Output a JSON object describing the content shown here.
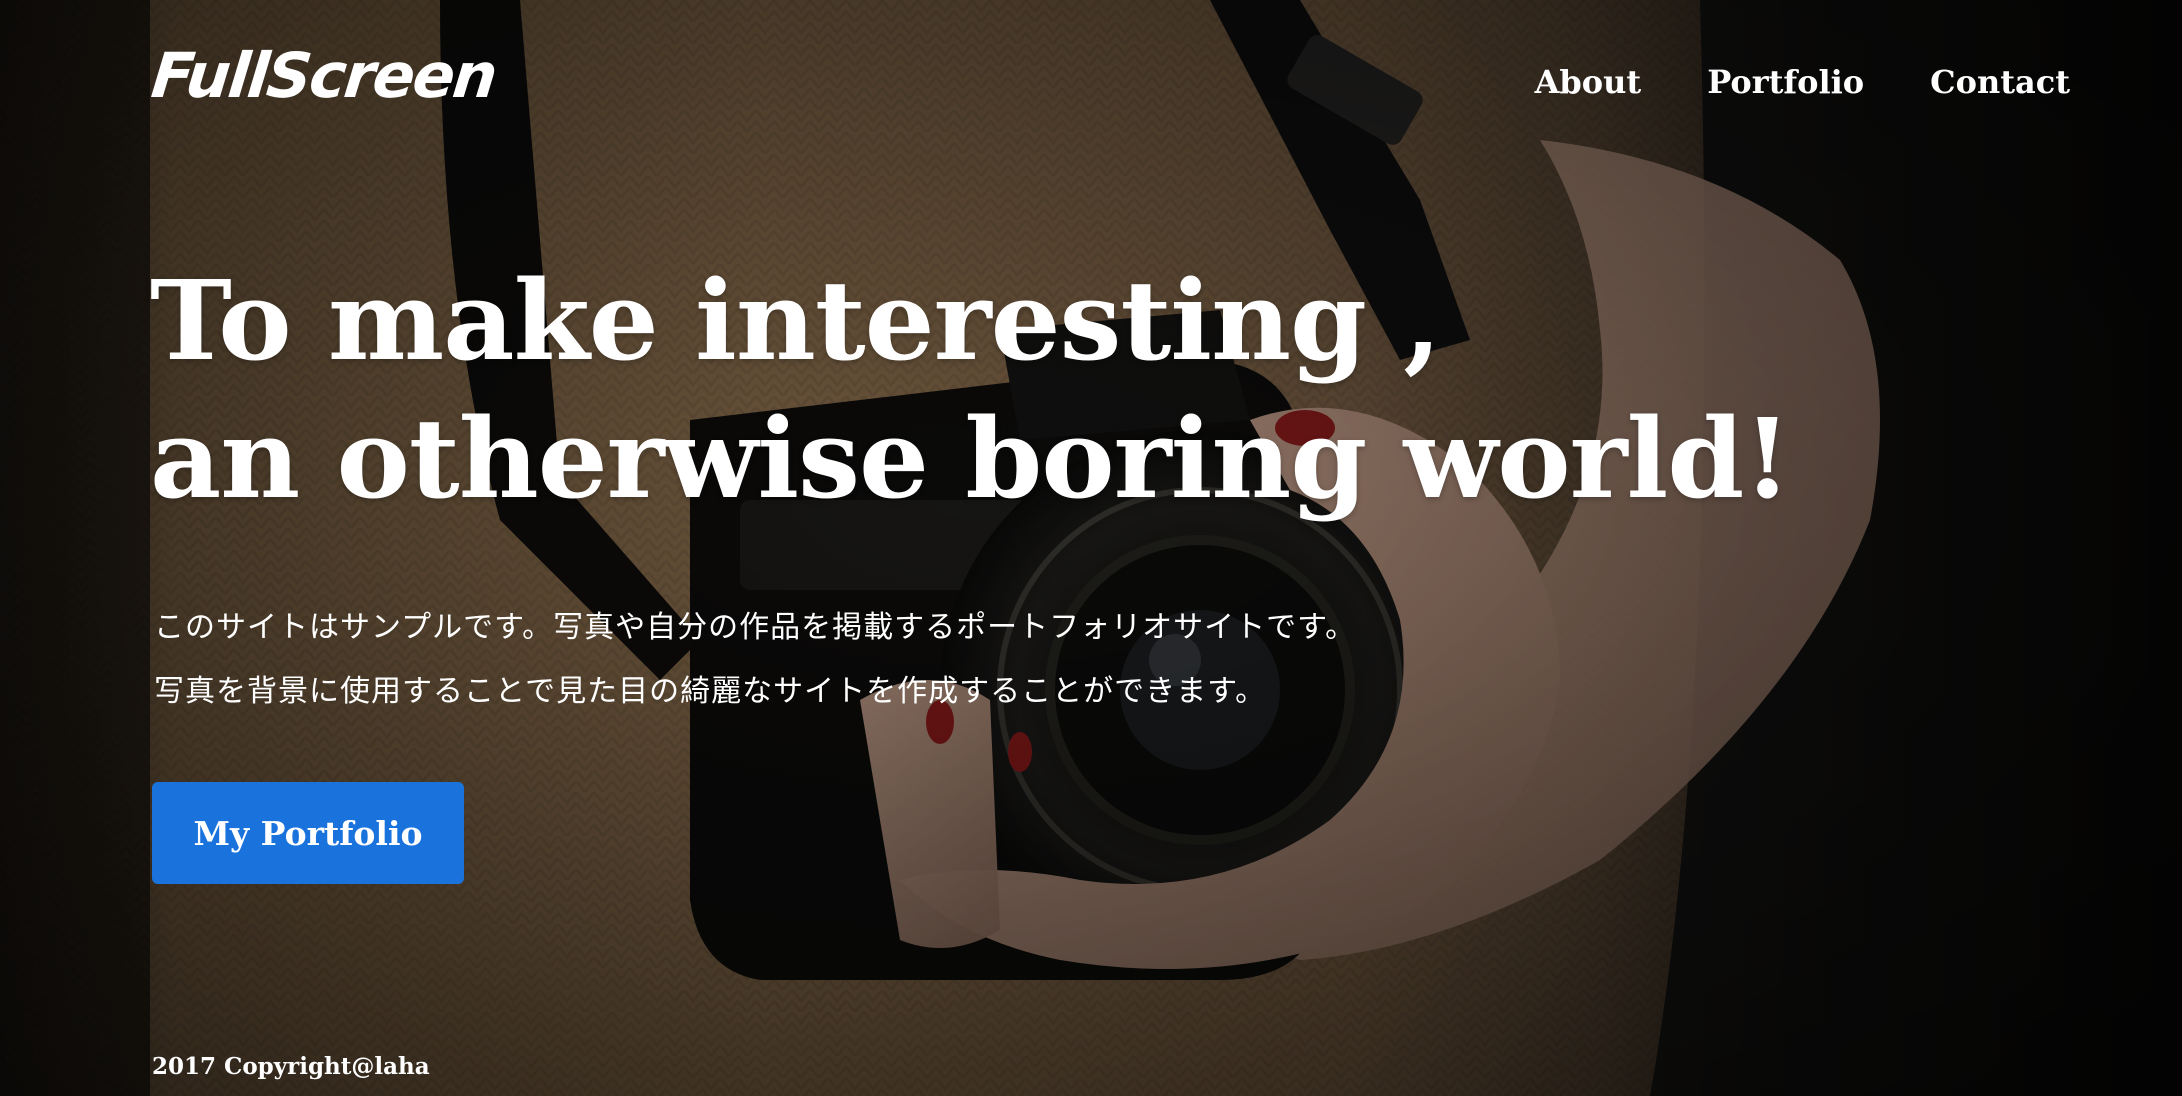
{
  "site": {
    "logo": "FullScreen"
  },
  "nav": {
    "items": [
      {
        "label": "About"
      },
      {
        "label": "Portfolio"
      },
      {
        "label": "Contact"
      }
    ]
  },
  "hero": {
    "headline_line1": "To make interesting ,",
    "headline_line2": "an otherwise boring world!",
    "description_line1": "このサイトはサンプルです。写真や自分の作品を掲載するポートフォリオサイトです。",
    "description_line2": "写真を背景に使用することで見た目の綺麗なサイトを作成することができます。",
    "cta_label": "My Portfolio",
    "background_image": "camera-photo",
    "accent_color": "#1a73dc"
  },
  "footer": {
    "copyright": "2017 Copyright@laha"
  }
}
